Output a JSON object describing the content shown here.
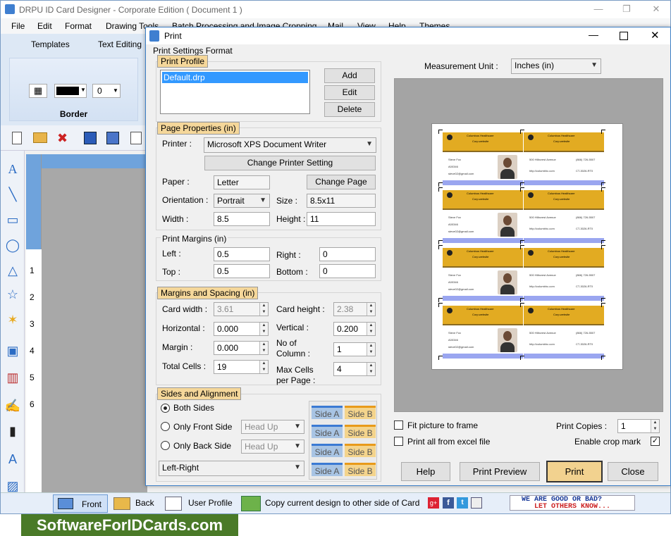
{
  "app": {
    "title": "DRPU ID Card Designer - Corporate Edition ( Document 1 )",
    "menu": [
      "File",
      "Edit",
      "Format",
      "Drawing Tools",
      "Batch Processing and Image Cropping",
      "Mail",
      "View",
      "Help",
      "Themes"
    ],
    "ribbon_tabs": [
      "Templates",
      "Text Editing"
    ],
    "border_panel": {
      "label": "Border",
      "width_value": "0"
    },
    "ruler_numbers": [
      "1",
      "2",
      "3",
      "4",
      "5",
      "6"
    ],
    "status_tabs": {
      "front": "Front",
      "back": "Back",
      "user_profile": "User Profile",
      "copy": "Copy current design to other side of Card"
    },
    "feedback": {
      "line1": "WE ARE GOOD OR BAD?",
      "line2": "LET OTHERS KNOW..."
    },
    "footer": "SoftwareForIDCards.com"
  },
  "dialog": {
    "title": "Print",
    "settings_label": "Print Settings Format",
    "print_profile": {
      "header": "Print Profile",
      "items": [
        "Default.drp"
      ],
      "add": "Add",
      "edit": "Edit",
      "delete": "Delete"
    },
    "page_properties": {
      "header": "Page Properties (in)",
      "printer_label": "Printer :",
      "printer_value": "Microsoft XPS Document Writer",
      "change_printer": "Change Printer Setting",
      "paper_label": "Paper :",
      "paper_value": "Letter",
      "change_page": "Change Page",
      "orientation_label": "Orientation :",
      "orientation_value": "Portrait",
      "size_label": "Size :",
      "size_value": "8.5x11",
      "width_label": "Width :",
      "width_value": "8.5",
      "height_label": "Height :",
      "height_value": "11"
    },
    "print_margins": {
      "header": "Print Margins (in)",
      "left_label": "Left :",
      "left_value": "0.5",
      "right_label": "Right :",
      "right_value": "0",
      "top_label": "Top :",
      "top_value": "0.5",
      "bottom_label": "Bottom :",
      "bottom_value": "0"
    },
    "margins_spacing": {
      "header": "Margins and Spacing (in)",
      "card_width_label": "Card width :",
      "card_width_value": "3.61",
      "card_height_label": "Card height :",
      "card_height_value": "2.38",
      "horizontal_label": "Horizontal :",
      "horizontal_value": "0.000",
      "vertical_label": "Vertical :",
      "vertical_value": "0.200",
      "margin_label": "Margin :",
      "margin_value": "0.000",
      "columns_label_1": "No of",
      "columns_label_2": "Column :",
      "columns_value": "1",
      "total_cells_label": "Total Cells :",
      "total_cells_value": "19",
      "max_cells_label_1": "Max Cells",
      "max_cells_label_2": "per Page :",
      "max_cells_value": "4"
    },
    "sides_alignment": {
      "header": "Sides and Alignment",
      "both": "Both Sides",
      "front_only": "Only Front Side",
      "back_only": "Only Back Side",
      "head_up": "Head Up",
      "alignment_value": "Left-Right",
      "side_a": "Side A",
      "side_b": "Side B"
    },
    "measurement": {
      "label": "Measurement Unit :",
      "value": "Inches (in)"
    },
    "fit_picture": "Fit picture to frame",
    "print_excel": "Print all from excel file",
    "print_copies_label": "Print Copies :",
    "print_copies_value": "1",
    "enable_crop_label": "Enable crop mark",
    "buttons": {
      "help": "Help",
      "preview": "Print Preview",
      "print": "Print",
      "close": "Close"
    }
  },
  "card": {
    "company_line1": "Columbus Healthcare",
    "company_line2": "Corp.website",
    "name": "Steve Fox",
    "id": "A00346",
    "email": "steve02@gmail.com",
    "address": "500 Hilbcrest Avenue",
    "phone": "(866) 726-5507",
    "web": "http://columbhc.com",
    "code": "CT-3026-RT0"
  }
}
